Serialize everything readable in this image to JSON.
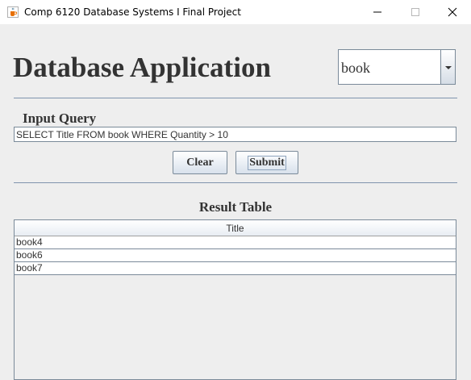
{
  "window": {
    "title": "Comp 6120 Database Systems I Final Project"
  },
  "heading": "Database Application",
  "table_selector": {
    "selected": "book"
  },
  "query": {
    "label": "Input Query",
    "value": "SELECT Title FROM book WHERE Quantity > 10"
  },
  "buttons": {
    "clear": "Clear",
    "submit": "Submit"
  },
  "results": {
    "label": "Result Table",
    "columns": [
      "Title"
    ],
    "rows": [
      "book4",
      "book6",
      "book7"
    ]
  },
  "colors": {
    "background": "#eeeeee",
    "separator": "#7f93ad",
    "border": "#7a8a99"
  },
  "icons": {
    "app": "java-coffee-cup-icon",
    "minimize": "minimize-icon",
    "maximize": "maximize-icon",
    "close": "close-icon",
    "dropdown": "triangle-down-icon"
  }
}
